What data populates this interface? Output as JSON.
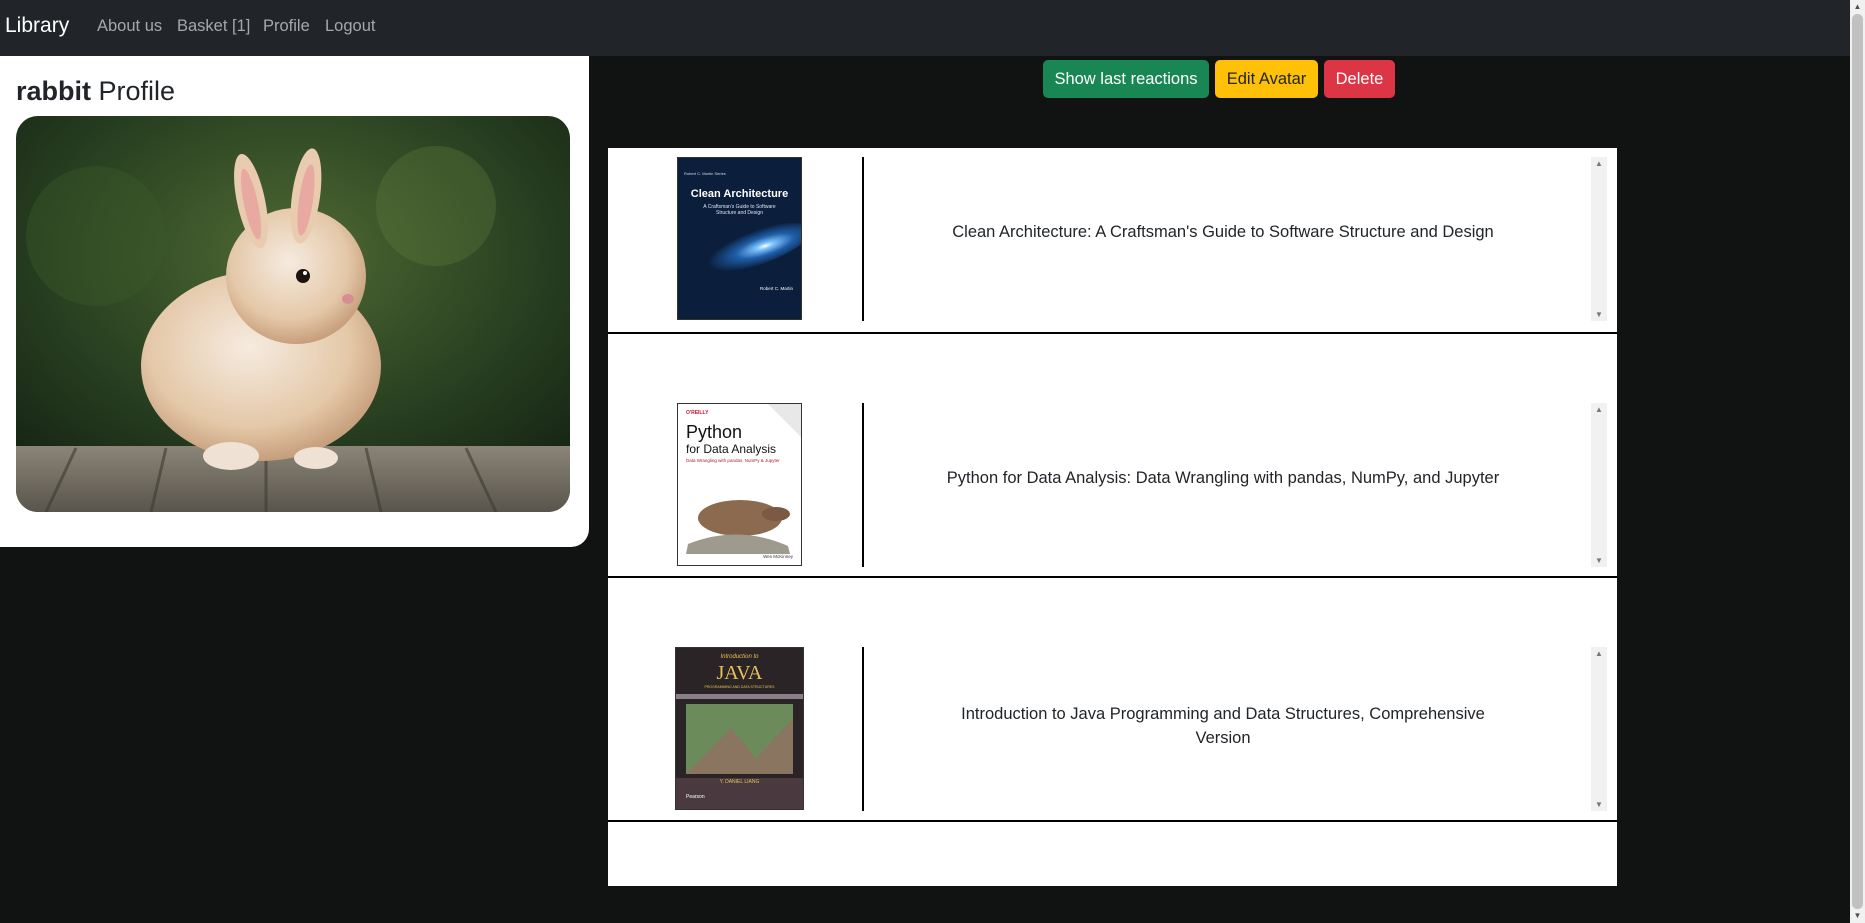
{
  "navbar": {
    "brand": "Library",
    "links": [
      "About us",
      "Basket [1]",
      "Profile",
      "Logout"
    ]
  },
  "profile": {
    "username": "rabbit",
    "title_suffix": " Profile"
  },
  "actions": {
    "show_reactions": "Show last reactions",
    "edit_avatar": "Edit Avatar",
    "delete": "Delete"
  },
  "books": [
    {
      "title": "Clean Architecture: A Craftsman's Guide to Software Structure and Design",
      "cover": {
        "series": "Robert C. Martin Series",
        "heading": "Clean Architecture",
        "subtitle": "A Craftsman's Guide to Software Structure and Design",
        "author": "Robert C. Martin"
      }
    },
    {
      "title": "Python for Data Analysis: Data Wrangling with pandas, NumPy, and Jupyter",
      "cover": {
        "publisher": "O'REILLY",
        "heading_1": "Python",
        "heading_2": "for Data Analysis",
        "subtitle": "Data Wrangling with pandas, NumPy & Jupyter",
        "author": "Wes McKinney"
      }
    },
    {
      "title": "Introduction to Java Programming and Data Structures, Comprehensive Version",
      "cover": {
        "intro": "Introduction to",
        "heading": "JAVA",
        "sub": "PROGRAMMING AND DATA STRUCTURES",
        "author": "Y. DANIEL LIANG",
        "publisher": "Pearson"
      }
    }
  ],
  "colors": {
    "navbar_bg": "#212529",
    "page_bg": "#111313",
    "success": "#198754",
    "warning": "#ffc107",
    "danger": "#dc3545"
  }
}
